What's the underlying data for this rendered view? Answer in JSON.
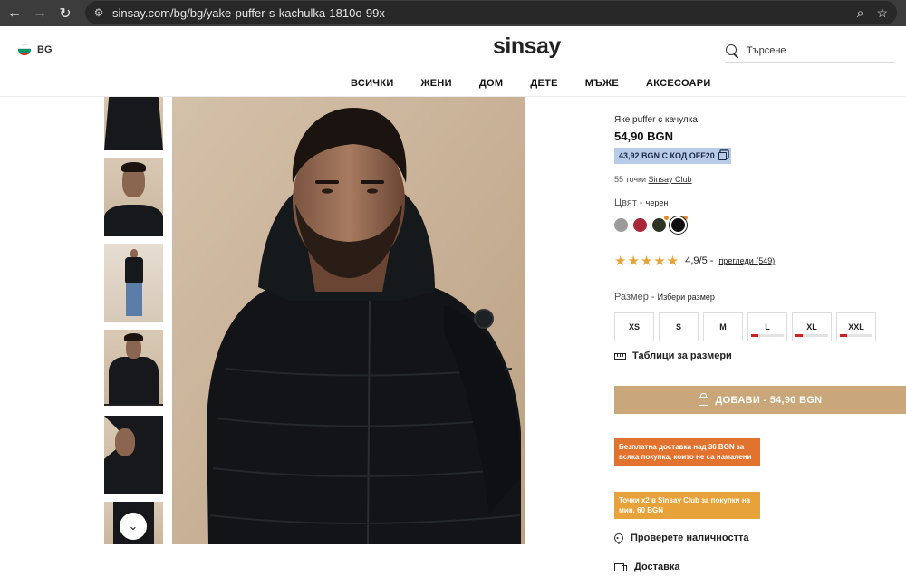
{
  "browser": {
    "url": "sinsay.com/bg/bg/yake-puffer-s-kachulka-1810o-99x"
  },
  "header": {
    "language": "BG",
    "logo": "sinsay",
    "search_placeholder": "Търсене",
    "menu": [
      "ВСИЧКИ",
      "ЖЕНИ",
      "ДОМ",
      "ДЕТЕ",
      "МЪЖЕ",
      "АКСЕСОАРИ"
    ]
  },
  "product": {
    "name": "Яке puffer с качулка",
    "price": "54,90 BGN",
    "promo": "43,92 BGN С КОД OFF20",
    "points_text": "55 точки",
    "points_link": "Sinsay Club",
    "color_label": "Цвят -",
    "color_value": "черен",
    "swatches": [
      {
        "name": "grey",
        "color": "#9b9b9b"
      },
      {
        "name": "burgundy",
        "color": "#a8283a"
      },
      {
        "name": "dark-olive",
        "color": "#2e3326"
      },
      {
        "name": "black",
        "color": "#111111"
      }
    ],
    "rating_stars": 5,
    "rating_text": "4,9/5 -",
    "reviews_link": "прегледи (549)",
    "size_label": "Размер -",
    "size_value": "Избери размер",
    "sizes": [
      "XS",
      "S",
      "M",
      "L",
      "XL",
      "XXL"
    ],
    "size_tables": "Таблици за размери",
    "add_to_cart": "ДОБАВИ - 54,90 BGN",
    "banner_delivery": "Безплатна доставка над 36 BGN за всяка покупка, които не са намалени",
    "banner_points": "Точки x2 в Sinsay Club за покупки на мин. 60 BGN",
    "check_availability": "Проверете наличността",
    "delivery": "Доставка"
  },
  "colors": {
    "accent": "#c9a77a",
    "promo_bg": "#b8cce8",
    "banner_orange": "#e1732f",
    "banner_amber": "#e7a23a",
    "star": "#e8a33a",
    "low_stock": "#cc2222"
  }
}
